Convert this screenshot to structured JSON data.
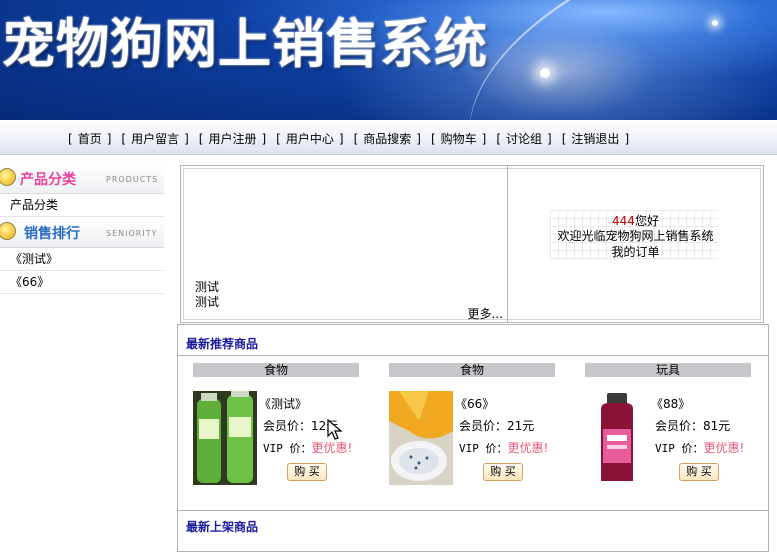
{
  "site_title": "宠物狗网上销售系统",
  "nav": {
    "items": [
      "首页",
      "用户留言",
      "用户注册",
      "用户中心",
      "商品搜索",
      "购物车",
      "讨论组",
      "注销退出"
    ],
    "open_bracket": "[",
    "close_bracket": "]"
  },
  "sidebar": {
    "category_title": "产品分类",
    "category_sub": "PRODUCTS",
    "category_items": [
      "产品分类"
    ],
    "ranking_title": "销售排行",
    "ranking_sub": "SENIORITY",
    "ranking_items": [
      "《测试》",
      "《66》"
    ]
  },
  "news": {
    "items": [
      "测试",
      "测试"
    ],
    "more": "更多..."
  },
  "welcome": {
    "username": "444",
    "greeting": "您好",
    "line2": "欢迎光临宠物狗网上销售系统",
    "link": "我的订单"
  },
  "recommended": {
    "title": "最新推荐商品",
    "products": [
      {
        "category": "食物",
        "name": "《测试》",
        "member_price": "会员价：12元",
        "vip_label": "VIP 价：",
        "vip_value": "更优惠!",
        "buy": "购 买"
      },
      {
        "category": "食物",
        "name": "《66》",
        "member_price": "会员价：21元",
        "vip_label": "VIP 价：",
        "vip_value": "更优惠!",
        "buy": "购 买"
      },
      {
        "category": "玩具",
        "name": "《88》",
        "member_price": "会员价：81元",
        "vip_label": "VIP 价：",
        "vip_value": "更优惠!",
        "buy": "购 买"
      }
    ]
  },
  "newest": {
    "title": "最新上架商品"
  },
  "colors": {
    "section_title": "#1a1aa0",
    "username": "#c00000",
    "vip_highlight": "#e85a7a"
  }
}
